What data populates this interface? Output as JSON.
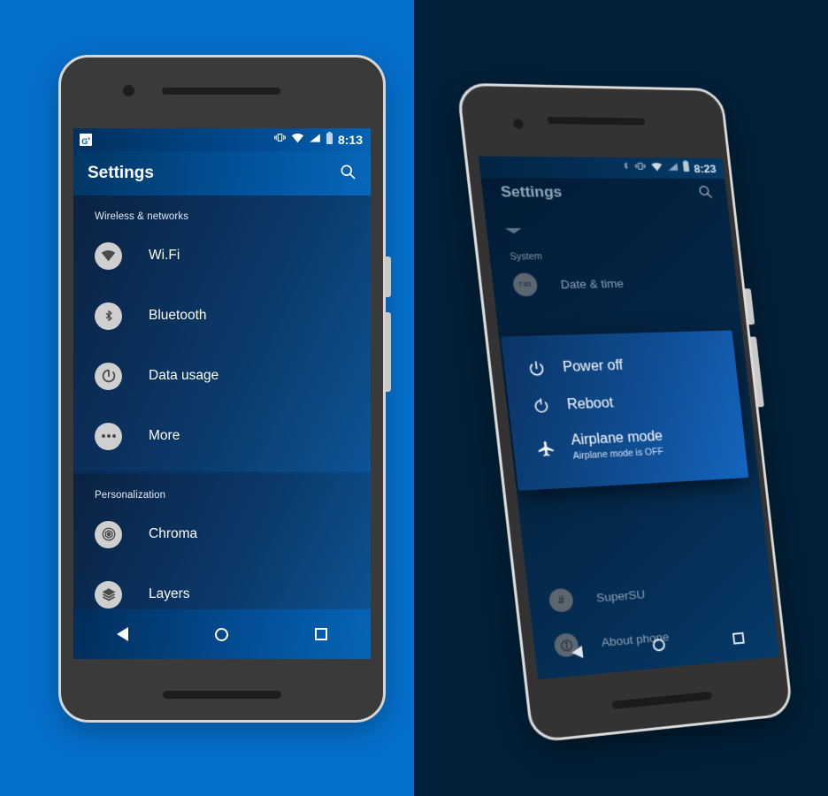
{
  "colors": {
    "left_background": "#0570cc",
    "right_background": "#012039",
    "dialog_accent": "#1565c0",
    "icon_circle": "#cfcfcf"
  },
  "left_phone": {
    "status_bar": {
      "notification_icon": "google-plus-icon",
      "icons": [
        "vibrate-icon",
        "wifi-icon",
        "signal-icon",
        "battery-icon"
      ],
      "time": "8:13"
    },
    "app_bar": {
      "title": "Settings",
      "search_icon": "search-icon"
    },
    "sections": [
      {
        "title": "Wireless & networks",
        "items": [
          {
            "icon": "wifi-icon",
            "label": "Wi.Fi"
          },
          {
            "icon": "bluetooth-icon",
            "label": "Bluetooth"
          },
          {
            "icon": "data-usage-icon",
            "label": "Data usage"
          },
          {
            "icon": "more-icon",
            "label": "More"
          }
        ]
      },
      {
        "title": "Personalization",
        "items": [
          {
            "icon": "chroma-icon",
            "label": "Chroma"
          },
          {
            "icon": "layers-icon",
            "label": "Layers"
          }
        ]
      }
    ],
    "nav_bar": {
      "back": "back-icon",
      "home": "home-icon",
      "recents": "recents-icon"
    }
  },
  "right_phone": {
    "status_bar": {
      "icons": [
        "bluetooth-icon",
        "vibrate-icon",
        "wifi-icon",
        "signal-icon",
        "battery-icon"
      ],
      "time": "8:23"
    },
    "app_bar": {
      "title": "Settings",
      "search_icon": "search-icon"
    },
    "sections": [
      {
        "title": "System",
        "items": [
          {
            "icon": "clock-icon",
            "label": "Date & time"
          }
        ]
      },
      {
        "title": "",
        "items": [
          {
            "icon": "hash-icon",
            "label": "SuperSU"
          },
          {
            "icon": "info-icon",
            "label": "About phone"
          }
        ]
      }
    ],
    "power_dialog": {
      "options": [
        {
          "icon": "power-icon",
          "label": "Power off",
          "sub": ""
        },
        {
          "icon": "reboot-icon",
          "label": "Reboot",
          "sub": ""
        },
        {
          "icon": "airplane-icon",
          "label": "Airplane mode",
          "sub": "Airplane mode is OFF"
        }
      ]
    },
    "nav_bar": {
      "back": "back-icon",
      "home": "home-icon",
      "recents": "recents-icon"
    }
  }
}
